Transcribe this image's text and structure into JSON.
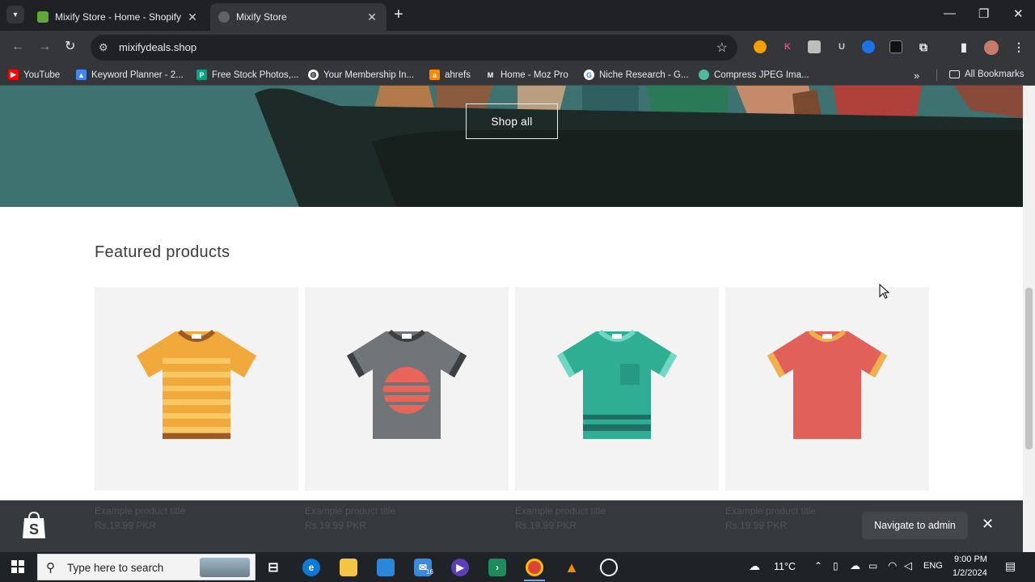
{
  "browser": {
    "tabs": [
      {
        "label": "Mixify Store - Home - Shopify",
        "favicon_color": "#5fa83a",
        "active": false
      },
      {
        "label": "Mixify Store",
        "favicon_color": "#7a7d82",
        "active": true
      }
    ],
    "url": "mixifydeals.shop",
    "bookmarks": [
      {
        "label": "YouTube",
        "icon_color": "#ff0000",
        "icon": "youtube-icon"
      },
      {
        "label": "Keyword Planner - 2...",
        "icon_color": "#4285f4",
        "icon": "google-ads-icon"
      },
      {
        "label": "Free Stock Photos,...",
        "icon_color": "#07a081",
        "icon": "pexels-icon"
      },
      {
        "label": "Your Membership In...",
        "icon_color": "#ffffff",
        "icon": "globe-icon"
      },
      {
        "label": "ahrefs",
        "icon_color": "#ff8800",
        "icon": "ahrefs-icon"
      },
      {
        "label": "Home - Moz Pro",
        "icon_color": "#1b1b1b",
        "icon": "moz-icon"
      },
      {
        "label": "Niche Research - G...",
        "icon_color": "#ffffff",
        "icon": "google-icon"
      },
      {
        "label": "Compress JPEG Ima...",
        "icon_color": "#4dbba0",
        "icon": "leaf-icon"
      }
    ],
    "all_bookmarks": "All Bookmarks"
  },
  "page": {
    "hero_button": "Shop all",
    "section_title": "Featured products",
    "products": [
      {
        "title": "Example product title",
        "price": "Rs.19.99 PKR",
        "shirt": "striped-orange"
      },
      {
        "title": "Example product title",
        "price": "Rs.19.99 PKR",
        "shirt": "gray-sunset"
      },
      {
        "title": "Example product title",
        "price": "Rs.19.99 PKR",
        "shirt": "green-pocket"
      },
      {
        "title": "Example product title",
        "price": "Rs.19.99 PKR",
        "shirt": "red-plain"
      }
    ]
  },
  "admin_bar": {
    "navigate_label": "Navigate to admin"
  },
  "taskbar": {
    "search_placeholder": "Type here to search",
    "weather": "11°C",
    "language": "ENG",
    "time": "9:00 PM",
    "date": "1/2/2024",
    "mail_badge": "16"
  }
}
